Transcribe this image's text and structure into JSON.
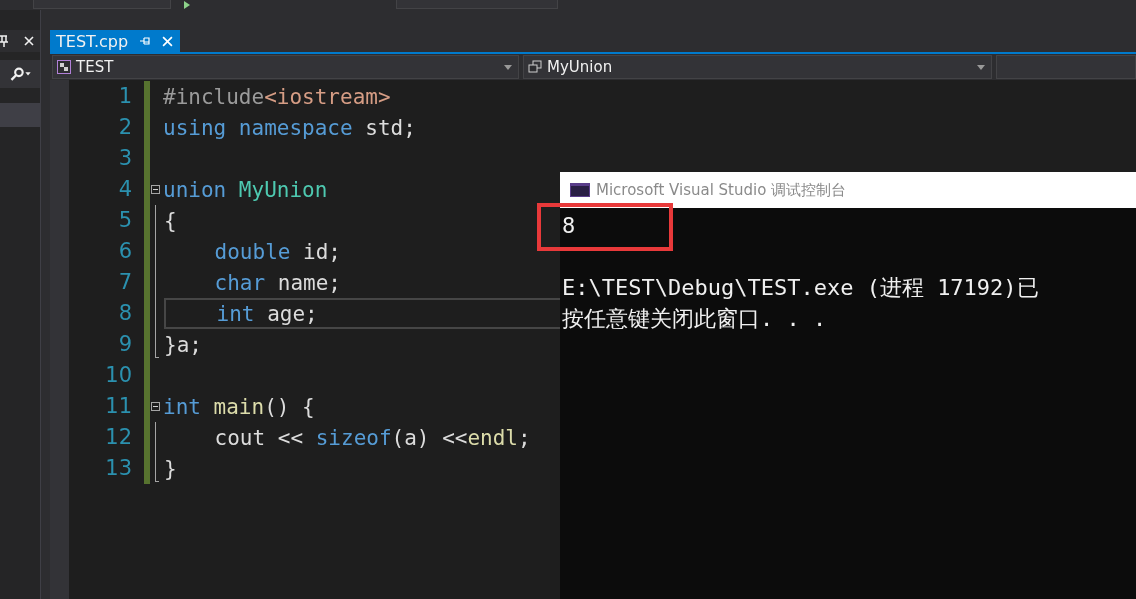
{
  "document_tab": {
    "label": "TEST.cpp",
    "selected": true
  },
  "navigation_bar": {
    "project": "TEST",
    "scope": "MyUnion"
  },
  "editor": {
    "lines": [
      {
        "number": "1",
        "collapsible": false,
        "in_block": false,
        "indented": false,
        "current": false,
        "tokens": [
          {
            "kind": "preprocessor",
            "text": "#include"
          },
          {
            "kind": "header",
            "text": "<iostream>"
          }
        ]
      },
      {
        "number": "2",
        "collapsible": false,
        "in_block": false,
        "indented": false,
        "current": false,
        "tokens": [
          {
            "kind": "keyword",
            "text": "using"
          },
          {
            "kind": "keyword",
            "text": " namespace"
          },
          {
            "kind": "plain",
            "text": " std;"
          }
        ]
      },
      {
        "number": "3",
        "collapsible": false,
        "in_block": false,
        "current": false
      },
      {
        "number": "4",
        "collapsible": true,
        "in_block": false,
        "indented": false,
        "current": false,
        "tokens": [
          {
            "kind": "keyword",
            "text": "union"
          },
          {
            "kind": "type",
            "text": " MyUnion"
          }
        ]
      },
      {
        "number": "5",
        "collapsible": false,
        "in_block": true,
        "indented": false,
        "current": false,
        "tokens": [
          {
            "kind": "plain",
            "text": "{"
          }
        ]
      },
      {
        "number": "6",
        "collapsible": false,
        "in_block": true,
        "indented": true,
        "current": false,
        "tokens": [
          {
            "kind": "keyword",
            "text": "double"
          },
          {
            "kind": "plain",
            "text": " id;"
          }
        ]
      },
      {
        "number": "7",
        "collapsible": false,
        "in_block": true,
        "indented": true,
        "current": false,
        "tokens": [
          {
            "kind": "keyword",
            "text": "char"
          },
          {
            "kind": "plain",
            "text": " name;"
          }
        ]
      },
      {
        "number": "8",
        "collapsible": false,
        "in_block": true,
        "indented": true,
        "current": true,
        "tokens": [
          {
            "kind": "keyword",
            "text": "int"
          },
          {
            "kind": "plain",
            "text": " age;"
          }
        ]
      },
      {
        "number": "9",
        "collapsible": false,
        "in_block": true,
        "indented": false,
        "current": false,
        "tokens": [
          {
            "kind": "plain",
            "text": "}a;"
          }
        ]
      },
      {
        "number": "10",
        "collapsible": false,
        "in_block": false,
        "current": false
      },
      {
        "number": "11",
        "collapsible": true,
        "in_block": false,
        "indented": false,
        "current": false,
        "tokens": [
          {
            "kind": "keyword",
            "text": "int"
          },
          {
            "kind": "function",
            "text": " main"
          },
          {
            "kind": "plain",
            "text": "() {"
          }
        ]
      },
      {
        "number": "12",
        "collapsible": false,
        "in_block": true,
        "indented": true,
        "current": false,
        "tokens": [
          {
            "kind": "plain",
            "text": "cout << "
          },
          {
            "kind": "keyword",
            "text": "sizeof"
          },
          {
            "kind": "plain",
            "text": "(a) <<"
          },
          {
            "kind": "function",
            "text": "endl"
          },
          {
            "kind": "plain",
            "text": ";"
          }
        ]
      },
      {
        "number": "13",
        "collapsible": false,
        "in_block": true,
        "indented": false,
        "current": false,
        "tokens": [
          {
            "kind": "plain",
            "text": "}"
          }
        ]
      }
    ]
  },
  "console_window": {
    "title": "Microsoft Visual Studio 调试控制台",
    "lines": [
      {
        "text": "8",
        "gap_before": false
      },
      {
        "text": "E:\\TEST\\Debug\\TEST.exe (进程 17192)已",
        "gap_before": true
      },
      {
        "text": "按任意键关闭此窗口. . .",
        "gap_before": false
      }
    ]
  }
}
